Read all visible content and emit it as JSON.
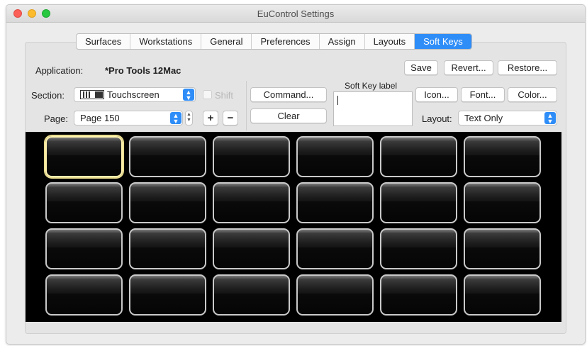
{
  "window": {
    "title": "EuControl Settings"
  },
  "tabs": [
    {
      "label": "Surfaces",
      "active": false
    },
    {
      "label": "Workstations",
      "active": false
    },
    {
      "label": "General",
      "active": false
    },
    {
      "label": "Preferences",
      "active": false
    },
    {
      "label": "Assign",
      "active": false
    },
    {
      "label": "Layouts",
      "active": false
    },
    {
      "label": "Soft Keys",
      "active": true
    }
  ],
  "application": {
    "label": "Application:",
    "value": "*Pro Tools 12Mac"
  },
  "actions": {
    "save": "Save",
    "revert": "Revert...",
    "restore": "Restore..."
  },
  "section": {
    "label": "Section:",
    "value": "Touchscreen",
    "shift_label": "Shift",
    "shift_checked": false
  },
  "page": {
    "label": "Page:",
    "value": "Page 150",
    "add": "+",
    "remove": "−"
  },
  "command": {
    "command_label": "Command...",
    "clear_label": "Clear"
  },
  "soft_key_label": {
    "label": "Soft Key label",
    "value": ""
  },
  "style": {
    "icon": "Icon...",
    "font": "Font...",
    "color": "Color..."
  },
  "layout": {
    "label": "Layout:",
    "value": "Text Only"
  },
  "keys": {
    "rows": 4,
    "columns": 6,
    "selected_index": 0
  },
  "colors": {
    "accent": "#2f8df8",
    "selected_key_border": "#fff3b0",
    "grid_background": "#000000"
  }
}
